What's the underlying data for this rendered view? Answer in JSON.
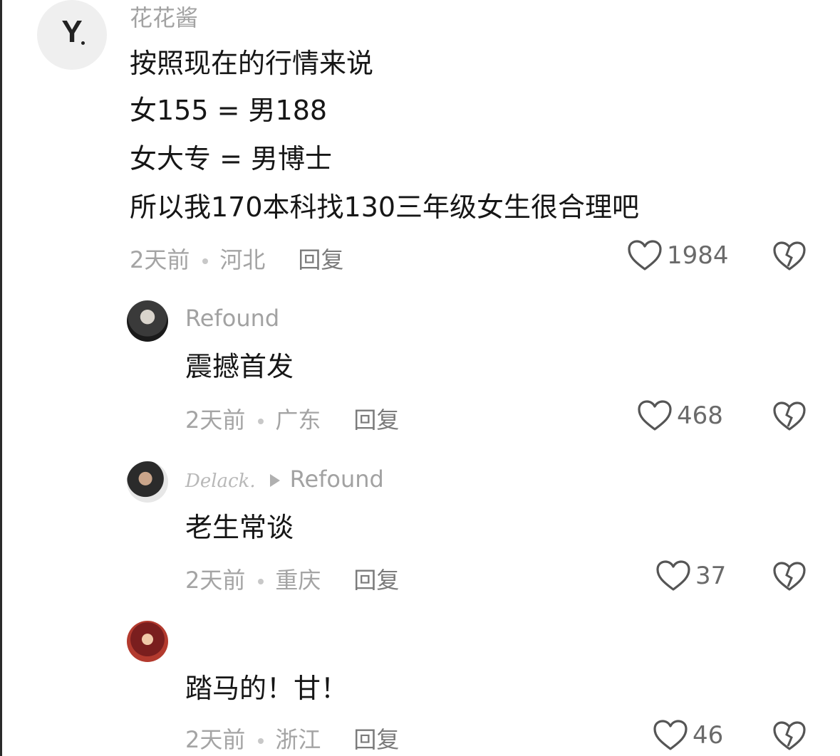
{
  "comments": [
    {
      "username": "花花酱",
      "avatar_letter": "Y",
      "lines": [
        "按照现在的行情来说",
        "女155 = 男188",
        "女大专 = 男博士",
        "所以我170本科找130三年级女生很合理吧"
      ],
      "time": "2天前",
      "location": "河北",
      "reply_label": "回复",
      "likes": "1984"
    },
    {
      "username": "Refound",
      "text": "震撼首发",
      "time": "2天前",
      "location": "广东",
      "reply_label": "回复",
      "likes": "468"
    },
    {
      "username": "Delack.",
      "reply_to": "Refound",
      "text": "老生常谈",
      "time": "2天前",
      "location": "重庆",
      "reply_label": "回复",
      "likes": "37"
    },
    {
      "username": "",
      "text": "踏马的！甘！",
      "time": "2天前",
      "location": "浙江",
      "reply_label": "回复",
      "likes": "46"
    }
  ]
}
